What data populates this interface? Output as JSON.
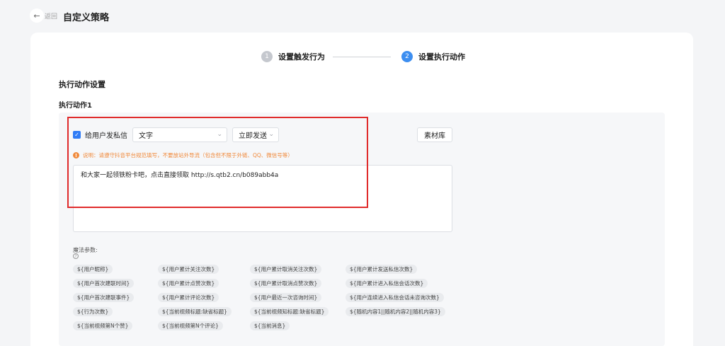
{
  "header": {
    "back_label": "返回",
    "title": "自定义策略"
  },
  "steps": [
    {
      "num": "1",
      "label": "设置触发行为"
    },
    {
      "num": "2",
      "label": "设置执行动作"
    }
  ],
  "section_title": "执行动作设置",
  "action_title": "执行动作1",
  "action": {
    "checkbox_label": "给用户发私信",
    "type_select": "文字",
    "timing_select": "立即发送",
    "material_button": "素材库",
    "notice": "说明：请遵守抖音平台规范填写，不要放站外导流（包含但不限于外链、QQ、微信号等）",
    "message": "和大家一起领铁粉卡吧，点击直接领取 http://s.qtb2.cn/b089abb4a"
  },
  "magic": {
    "title": "魔法参数:",
    "help": "?",
    "tags": [
      "${用户昵称}",
      "${用户累计关注次数}",
      "${用户累计取消关注次数}",
      "${用户累计发送私信次数}",
      "${用户首次建联时间}",
      "${用户累计点赞次数}",
      "${用户累计取消点赞次数}",
      "${用户累计进入私信会话次数}",
      "${用户首次建联事件}",
      "${用户累计评论次数}",
      "${用户最近一次咨询时间}",
      "${用户连续进入私信会话未咨询次数}",
      "${行为次数}",
      "${当前视频标题:缺省标题}",
      "${当前视频知标题:缺省标题}",
      "${随机内容1||随机内容2||随机内容3}",
      "${当前视频第N个赞}",
      "${当前视频第N个评论}",
      "${当前消息}"
    ]
  }
}
